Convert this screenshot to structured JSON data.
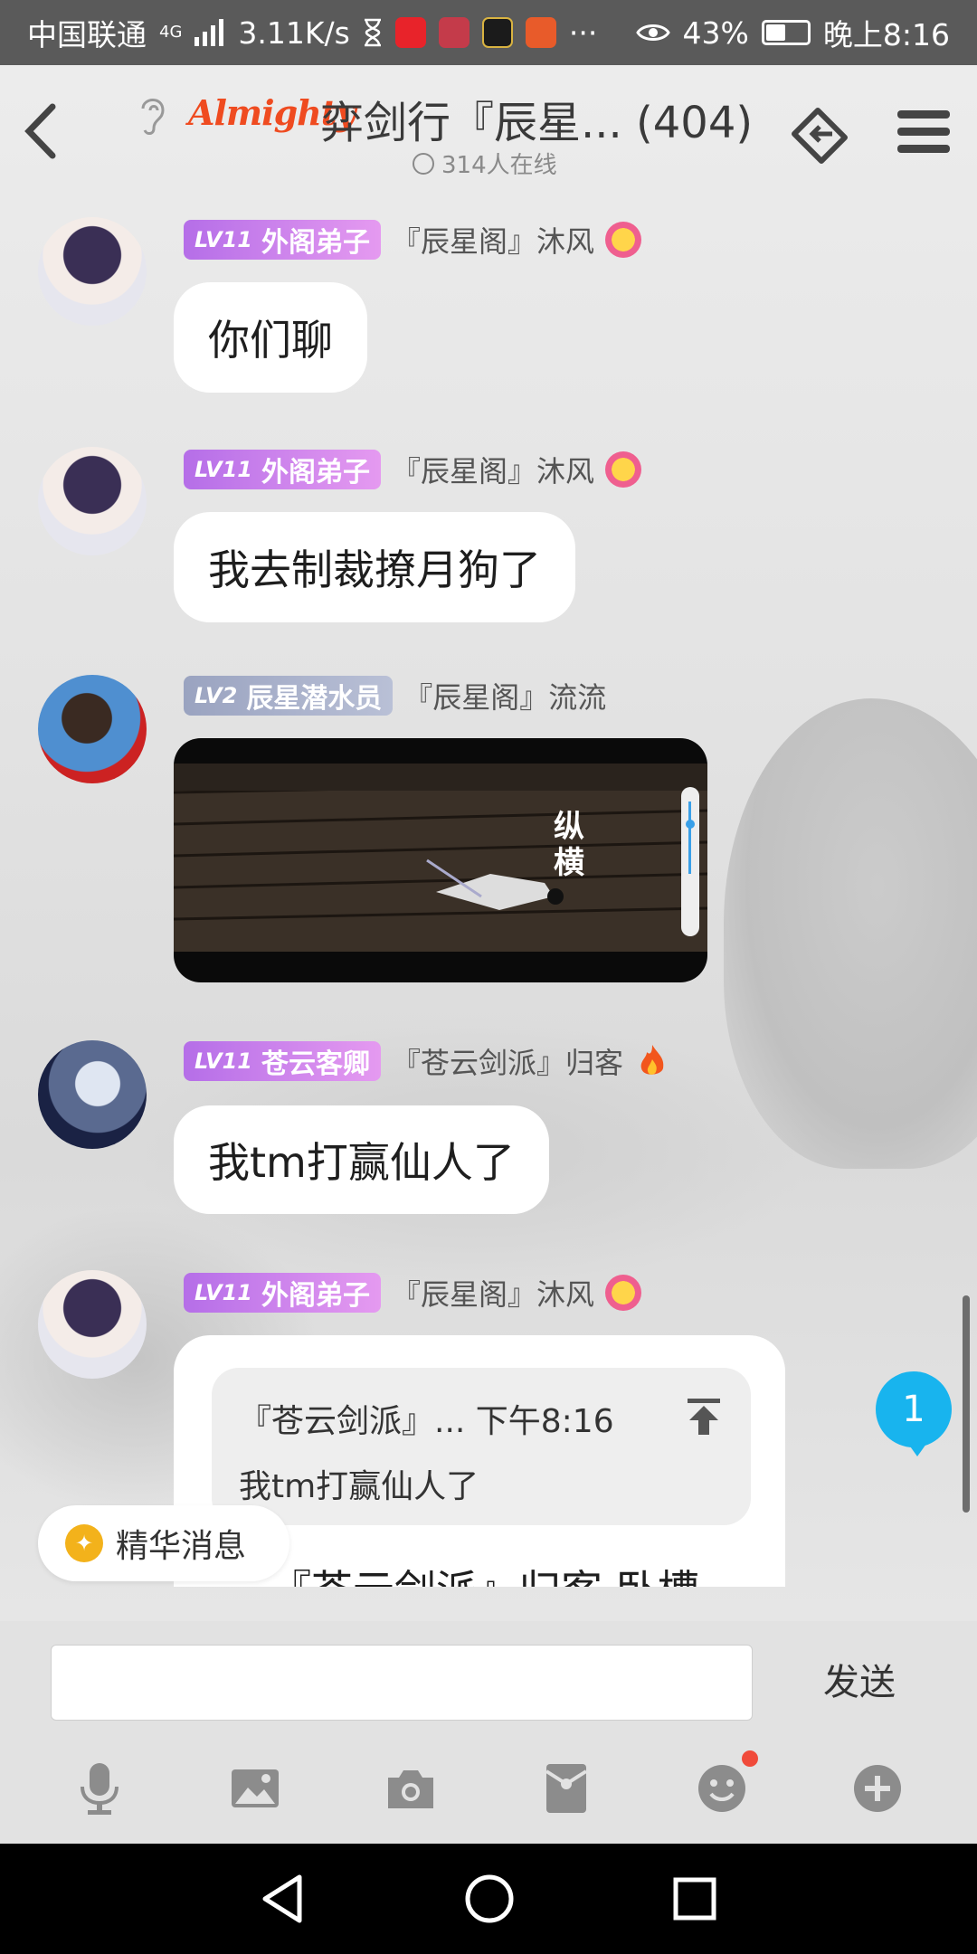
{
  "status_bar": {
    "carrier": "中国联通",
    "network": "4G",
    "speed": "3.11K/s",
    "more": "···",
    "battery": "43%",
    "battery_level": 0.43,
    "time": "晚上8:16"
  },
  "header": {
    "logo_text": "Almighty",
    "title": "弈剑行『辰星... (404)",
    "online": "314人在线"
  },
  "messages": [
    {
      "badge_level": "LV11",
      "badge_title": "外阁弟子",
      "nickname": "『辰星阁』沐风",
      "text": "你们聊"
    },
    {
      "badge_level": "LV11",
      "badge_title": "外阁弟子",
      "nickname": "『辰星阁』沐风",
      "text": "我去制裁撩月狗了"
    },
    {
      "badge_level": "LV2",
      "badge_title": "辰星潜水员",
      "nickname": "『辰星阁』流流",
      "video_caption": "纵横"
    },
    {
      "badge_level": "LV11",
      "badge_title": "苍云客卿",
      "nickname": "『苍云剑派』归客",
      "text": "我tm打赢仙人了"
    },
    {
      "badge_level": "LV11",
      "badge_title": "外阁弟子",
      "nickname": "『辰星阁』沐风"
    }
  ],
  "reply": {
    "quote_header": "『苍云剑派』... 下午8:16",
    "quote_text": "我tm打赢仙人了",
    "text": "『苍云剑派』归客 卧槽"
  },
  "essence_label": "精华消息",
  "unread_count": "1",
  "input": {
    "value": "",
    "send_label": "发送"
  },
  "colors": {
    "accent": "#18b4ee",
    "badge_purple": "#c07ae9",
    "logo": "#ef4b20"
  }
}
